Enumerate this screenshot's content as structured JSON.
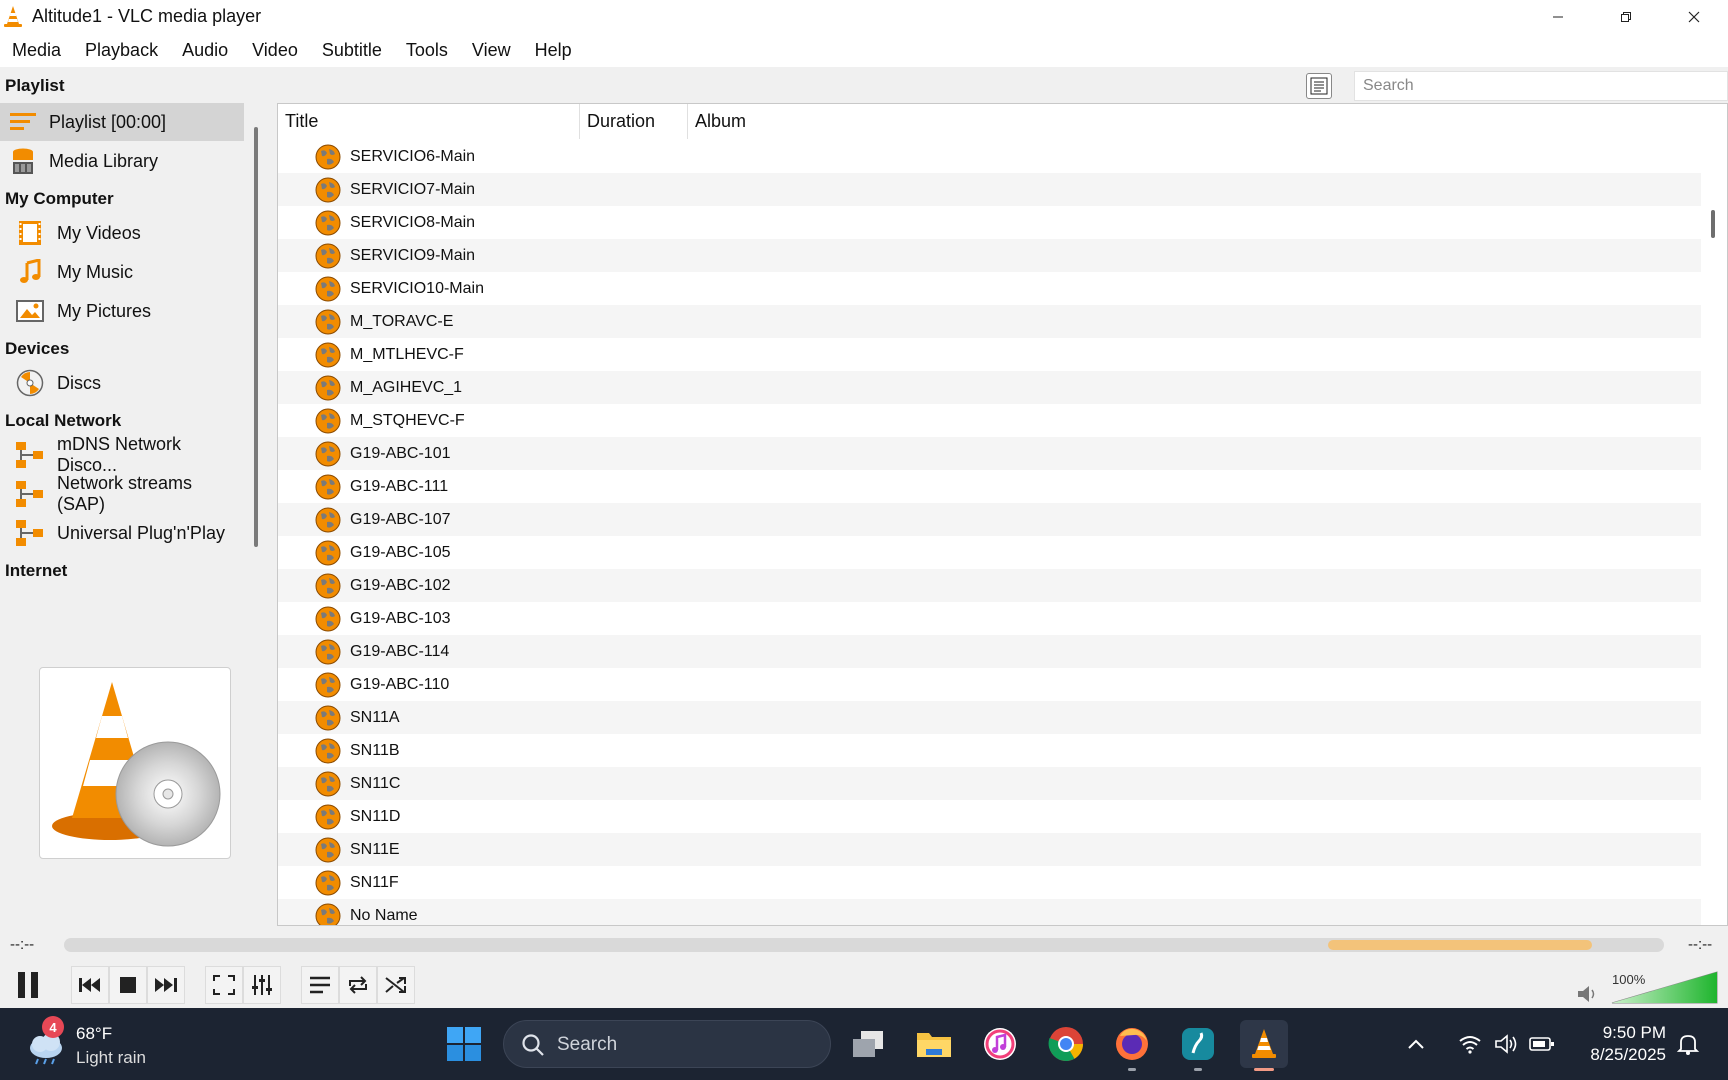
{
  "window": {
    "title": "Altitude1 - VLC media player"
  },
  "menu": [
    "Media",
    "Playback",
    "Audio",
    "Video",
    "Subtitle",
    "Tools",
    "View",
    "Help"
  ],
  "sidebar": {
    "sections": {
      "playlist": "Playlist",
      "my_computer": "My Computer",
      "devices": "Devices",
      "local_network": "Local Network",
      "internet": "Internet"
    },
    "items": {
      "playlist": "Playlist [00:00]",
      "media_library": "Media Library",
      "my_videos": "My Videos",
      "my_music": "My Music",
      "my_pictures": "My Pictures",
      "discs": "Discs",
      "mdns": "mDNS Network Disco...",
      "sap": "Network streams (SAP)",
      "upnp": "Universal Plug'n'Play"
    }
  },
  "playlist": {
    "search_placeholder": "Search",
    "columns": [
      "Title",
      "Duration",
      "Album"
    ],
    "rows": [
      "SERVICIO6-Main",
      "SERVICIO7-Main",
      "SERVICIO8-Main",
      "SERVICIO9-Main",
      "SERVICIO10-Main",
      "M_TORAVC-E",
      "M_MTLHEVC-F",
      "M_AGIHEVC_1",
      "M_STQHEVC-F",
      "G19-ABC-101",
      "G19-ABC-111",
      "G19-ABC-107",
      "G19-ABC-105",
      "G19-ABC-102",
      "G19-ABC-103",
      "G19-ABC-114",
      "G19-ABC-110",
      "SN11A",
      "SN11B",
      "SN11C",
      "SN11D",
      "SN11E",
      "SN11F",
      "No Name"
    ]
  },
  "player": {
    "elapsed": "--:--",
    "remaining": "--:--",
    "volume": "100%",
    "volume_level": 1.0
  },
  "taskbar": {
    "weather_badge": "4",
    "weather_temp": "68°F",
    "weather_desc": "Light rain",
    "search_label": "Search",
    "time": "9:50 PM",
    "date": "8/25/2025"
  },
  "colors": {
    "vlc_orange": "#f28c00",
    "seek_buffer": "#f3c37a",
    "volume_green": "#2fbf3f",
    "taskbar_bg": "#1c2432"
  }
}
